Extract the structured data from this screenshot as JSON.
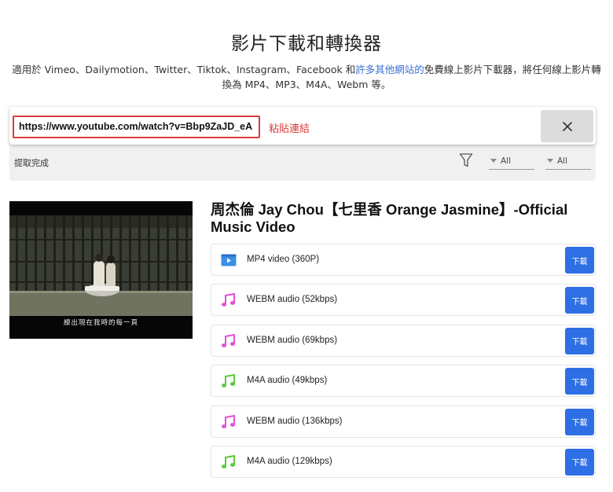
{
  "header": {
    "title": "影片下載和轉換器",
    "description_before": "適用於 Vimeo、Dailymotion、Twitter、Tiktok、Instagram、Facebook 和",
    "description_link": "許多其他網站的",
    "description_after": "免費線上影片下載器，將任何線上影片轉換為 MP4、MP3、M4A、Webm 等。"
  },
  "search": {
    "url_value": "https://www.youtube.com/watch?v=Bbp9ZaJD_eA",
    "paste_hint": "粘貼連結",
    "clear_icon": "close-icon"
  },
  "toolbar": {
    "status": "提取完成",
    "filter_icon": "filter-icon",
    "filter_type": "All",
    "filter_quality": "All"
  },
  "video": {
    "title": "周杰倫 Jay Chou【七里香 Orange Jasmine】-Official Music Video",
    "thumbnail_caption": "繚出現在我時的每一頁"
  },
  "formats": [
    {
      "label": "MP4 video (360P)",
      "icon": "video-file-icon",
      "icon_color": "#3b8fe6",
      "button": "下載"
    },
    {
      "label": "WEBM audio (52kbps)",
      "icon": "music-note-icon",
      "icon_color": "#e24fd6",
      "button": "下載"
    },
    {
      "label": "WEBM audio (69kbps)",
      "icon": "music-note-icon",
      "icon_color": "#e24fd6",
      "button": "下載"
    },
    {
      "label": "M4A audio (49kbps)",
      "icon": "music-note-icon",
      "icon_color": "#5cc93b",
      "button": "下載"
    },
    {
      "label": "WEBM audio (136kbps)",
      "icon": "music-note-icon",
      "icon_color": "#e24fd6",
      "button": "下載"
    },
    {
      "label": "M4A audio (129kbps)",
      "icon": "music-note-icon",
      "icon_color": "#5cc93b",
      "button": "下載"
    }
  ],
  "colors": {
    "accent_blue": "#2f6fe6",
    "link_blue": "#3b6fd4",
    "error_red": "#d93b3b"
  }
}
